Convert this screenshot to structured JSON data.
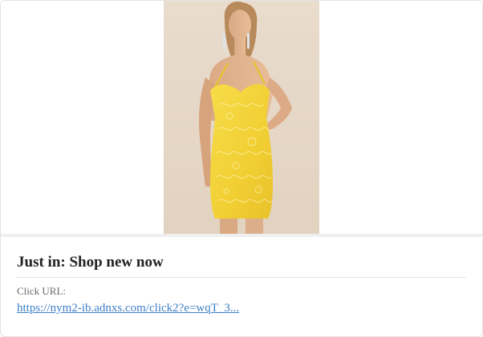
{
  "ad": {
    "image_alt": "Model wearing a yellow sequin lace mini dress",
    "headline": "Just in: Shop new now",
    "click_url_label": "Click URL:",
    "click_url": "https://nym2-ib.adnxs.com/click2?e=wqT_3..."
  },
  "colors": {
    "link": "#3d7fc7",
    "dress": "#f2d23a",
    "photo_background": "#e6d8c8"
  }
}
